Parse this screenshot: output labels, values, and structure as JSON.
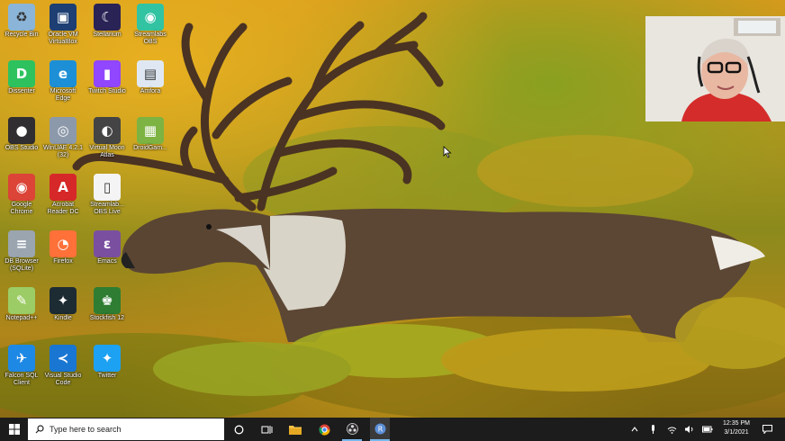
{
  "desktop_icons": [
    {
      "label": "Recycle Bin",
      "icon": "recycle-bin-icon"
    },
    {
      "label": "Oracle VM VirtualBox",
      "icon": "virtualbox-icon"
    },
    {
      "label": "Stellarium",
      "icon": "stellarium-icon"
    },
    {
      "label": "Streamlabs OBS",
      "icon": "streamlabs-icon"
    },
    {
      "label": "Dissenter",
      "icon": "dissenter-icon"
    },
    {
      "label": "Microsoft Edge",
      "icon": "edge-icon"
    },
    {
      "label": "Twitch Studio",
      "icon": "twitch-icon"
    },
    {
      "label": "Amfora",
      "icon": "amfora-icon"
    },
    {
      "label": "OBS Studio",
      "icon": "obs-icon"
    },
    {
      "label": "WinUAE 4.2.1 (32)",
      "icon": "winuae-icon"
    },
    {
      "label": "Virtual Moon Atlas",
      "icon": "moon-atlas-icon"
    },
    {
      "label": "DroidGam...",
      "icon": "android-icon"
    },
    {
      "label": "Google Chrome",
      "icon": "chrome-icon"
    },
    {
      "label": "Acrobat Reader DC",
      "icon": "acrobat-icon"
    },
    {
      "label": "Streamlab... OBS Live",
      "icon": "file-icon"
    },
    {
      "label": "DB Browser (SQLite)",
      "icon": "database-icon"
    },
    {
      "label": "Firefox",
      "icon": "firefox-icon"
    },
    {
      "label": "Emacs",
      "icon": "emacs-icon"
    },
    {
      "label": "Notepad++",
      "icon": "notepad-plus-icon"
    },
    {
      "label": "Kindle",
      "icon": "kindle-icon"
    },
    {
      "label": "Stockfish 12",
      "icon": "chess-icon"
    },
    {
      "label": "Falcon SQL Client",
      "icon": "falcon-icon"
    },
    {
      "label": "Visual Studio Code",
      "icon": "vscode-icon"
    },
    {
      "label": "Twitter",
      "icon": "twitter-icon"
    }
  ],
  "taskbar": {
    "search_placeholder": "Type here to search",
    "clock_time": "12:35 PM",
    "clock_date": "3/1/2021",
    "pinned": [
      "cortana-icon",
      "task-view-icon",
      "file-explorer-icon",
      "chrome-icon",
      "obs-icon",
      "app-icon"
    ]
  },
  "colors": {
    "taskbar": "#1c1c1c",
    "accent": "#0078d7"
  }
}
